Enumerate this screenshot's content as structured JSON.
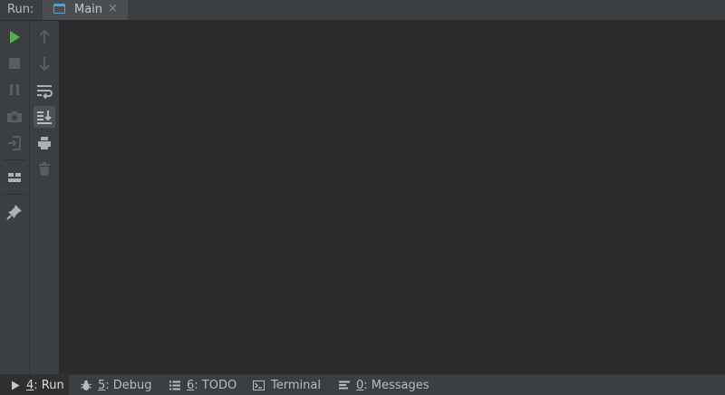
{
  "header": {
    "run_label": "Run:",
    "tab": {
      "label": "Main",
      "close": "×",
      "icon": "console-window-icon"
    }
  },
  "left_toolbar": {
    "primary": [
      {
        "name": "run-icon",
        "enabled": true,
        "color": "#4fb34f"
      },
      {
        "name": "stop-icon",
        "enabled": false
      },
      {
        "name": "pause-icon",
        "enabled": false
      },
      {
        "name": "camera-icon",
        "enabled": false
      },
      {
        "name": "exit-icon",
        "enabled": false
      },
      {
        "name": "layout-icon",
        "enabled": true
      },
      {
        "name": "pin-icon",
        "enabled": true
      }
    ],
    "secondary": [
      {
        "name": "arrow-up-icon",
        "enabled": false
      },
      {
        "name": "arrow-down-icon",
        "enabled": false
      },
      {
        "name": "soft-wrap-icon",
        "enabled": true
      },
      {
        "name": "scroll-to-end-icon",
        "enabled": true,
        "active": true
      },
      {
        "name": "print-icon",
        "enabled": true
      },
      {
        "name": "trash-icon",
        "enabled": false
      }
    ]
  },
  "bottom_bar": {
    "items": [
      {
        "num": "4",
        "label": ": Run",
        "selected": true
      },
      {
        "num": "5",
        "label": ": Debug"
      },
      {
        "num": "6",
        "label": ": TODO"
      },
      {
        "num": "",
        "label": "Terminal"
      },
      {
        "num": "0",
        "label": ": Messages"
      }
    ]
  },
  "colors": {
    "accent_run": "#4fb34f",
    "tab_icon": "#5aa0c8",
    "console_bg": "#2b2b2d"
  }
}
